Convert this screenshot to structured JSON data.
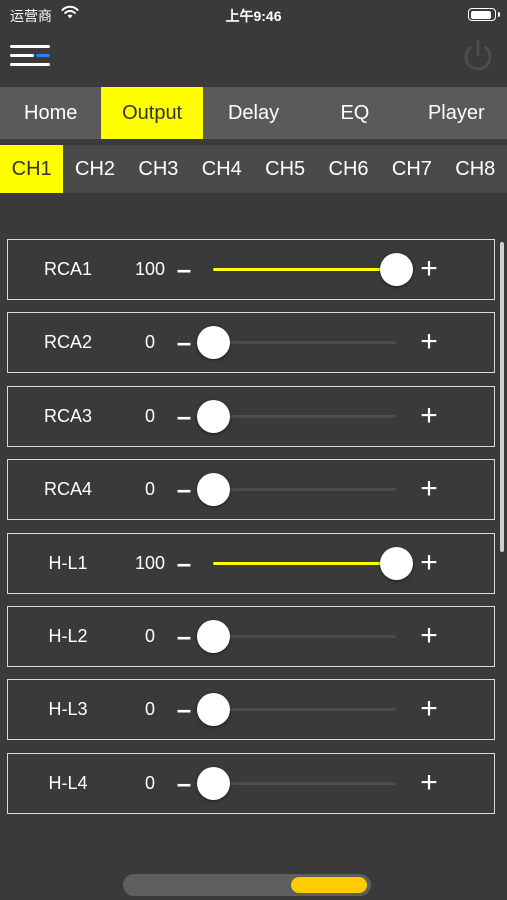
{
  "status_bar": {
    "carrier": "运营商",
    "time": "上午9:46",
    "wifi_icon": "wifi-icon",
    "battery_icon": "battery-icon",
    "battery_level": 0.9
  },
  "header": {
    "menu_icon": "menu-icon",
    "power_icon": "power-icon",
    "menu_line_colors": [
      "#ffffff",
      "#2a7fff"
    ]
  },
  "tabs": [
    {
      "label": "Home",
      "active": false
    },
    {
      "label": "Output",
      "active": true
    },
    {
      "label": "Delay",
      "active": false
    },
    {
      "label": "EQ",
      "active": false
    },
    {
      "label": "Player",
      "active": false
    }
  ],
  "channels": [
    {
      "label": "CH1",
      "active": true
    },
    {
      "label": "CH2",
      "active": false
    },
    {
      "label": "CH3",
      "active": false
    },
    {
      "label": "CH4",
      "active": false
    },
    {
      "label": "CH5",
      "active": false
    },
    {
      "label": "CH6",
      "active": false
    },
    {
      "label": "CH7",
      "active": false
    },
    {
      "label": "CH8",
      "active": false
    }
  ],
  "outputs": [
    {
      "name": "RCA1",
      "value": "100",
      "level": 100
    },
    {
      "name": "RCA2",
      "value": "0",
      "level": 0
    },
    {
      "name": "RCA3",
      "value": "0",
      "level": 0
    },
    {
      "name": "RCA4",
      "value": "0",
      "level": 0
    },
    {
      "name": "H-L1",
      "value": "100",
      "level": 100
    },
    {
      "name": "H-L2",
      "value": "0",
      "level": 0
    },
    {
      "name": "H-L3",
      "value": "0",
      "level": 0
    },
    {
      "name": "H-L4",
      "value": "0",
      "level": 0
    }
  ],
  "controls": {
    "minus": "–",
    "plus": "+"
  },
  "colors": {
    "accent": "#ffff00",
    "background": "#3a3a3a",
    "tab_bar": "#5a5a5a",
    "channel_bar": "#4a4a4a",
    "pager_active": "#ffcc00"
  },
  "pager": {
    "pages": 3,
    "current": 3
  }
}
